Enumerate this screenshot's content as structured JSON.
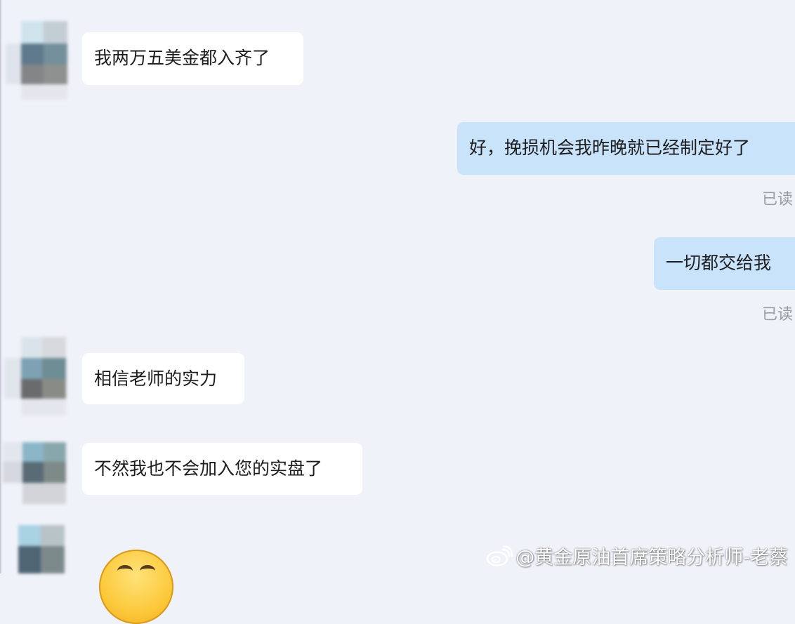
{
  "messages": [
    {
      "direction": "incoming",
      "text": "我两万五美金都入齐了"
    },
    {
      "direction": "outgoing",
      "text": "好，挽损机会我昨晚就已经制定好了",
      "status": "已读"
    },
    {
      "direction": "outgoing",
      "text": "一切都交给我",
      "status": "已读"
    },
    {
      "direction": "incoming",
      "text": "相信老师的实力"
    },
    {
      "direction": "incoming",
      "text": "不然我也不会加入您的实盘了"
    },
    {
      "direction": "incoming",
      "emoji": "smiling-face-emoji"
    }
  ],
  "watermark": {
    "icon": "weibo-logo-icon",
    "text": "@黄金原油首席策略分析师-老蔡"
  },
  "colors": {
    "background": "#f0f2f9",
    "incoming_bubble": "#ffffff",
    "outgoing_bubble": "#c9e3fb",
    "read_status": "#9a9ca3"
  }
}
